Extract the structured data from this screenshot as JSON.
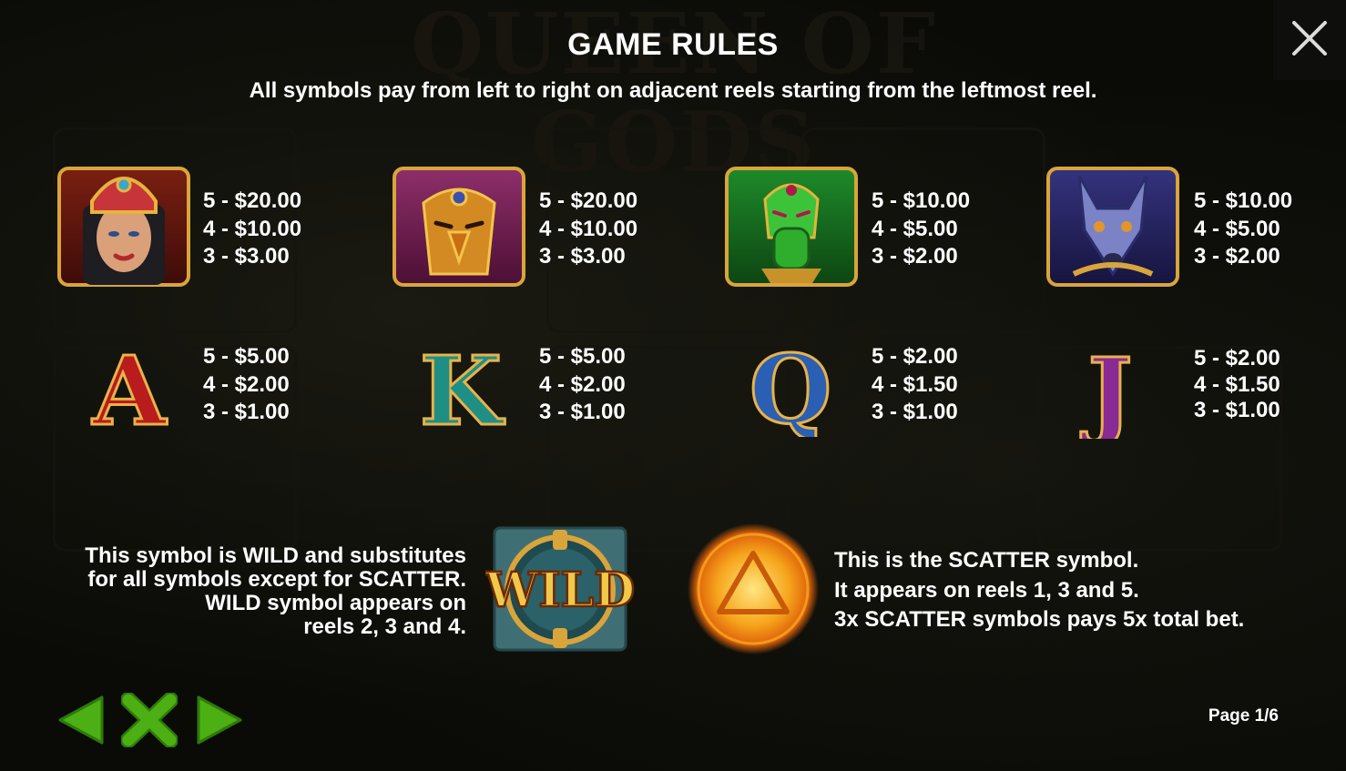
{
  "background": {
    "watermark_title": "QUEEN OF GODS"
  },
  "header": {
    "title": "GAME RULES",
    "subtitle": "All symbols pay from left to right on adjacent reels starting from the leftmost reel."
  },
  "symbols": [
    {
      "name": "queen",
      "pays": [
        "5 - $20.00",
        "4 - $10.00",
        "3 - $3.00"
      ]
    },
    {
      "name": "falcon",
      "pays": [
        "5 - $20.00",
        "4 - $10.00",
        "3 - $3.00"
      ]
    },
    {
      "name": "crocodile",
      "pays": [
        "5 - $10.00",
        "4 - $5.00",
        "3 - $2.00"
      ]
    },
    {
      "name": "jackal",
      "pays": [
        "5 - $10.00",
        "4 - $5.00",
        "3 - $2.00"
      ]
    },
    {
      "name": "letter-a",
      "letter": "A",
      "pays": [
        "5 - $5.00",
        "4 - $2.00",
        "3 - $1.00"
      ]
    },
    {
      "name": "letter-k",
      "letter": "K",
      "pays": [
        "5 - $5.00",
        "4 - $2.00",
        "3 - $1.00"
      ]
    },
    {
      "name": "letter-q",
      "letter": "Q",
      "pays": [
        "5 - $2.00",
        "4 - $1.50",
        "3 - $1.00"
      ]
    },
    {
      "name": "letter-j",
      "letter": "J",
      "pays": [
        "5 - $2.00",
        "4 - $1.50",
        "3 - $1.00"
      ]
    }
  ],
  "wild": {
    "icon_label": "WILD",
    "lines": [
      "This symbol is WILD and substitutes",
      "for all symbols except for SCATTER.",
      "WILD symbol appears on",
      "reels 2, 3 and 4."
    ]
  },
  "scatter": {
    "lines": [
      "This is the SCATTER symbol.",
      "It appears on reels 1, 3 and 5.",
      "3x SCATTER symbols pays 5x total bet."
    ]
  },
  "footer": {
    "page_label": "Page 1/6"
  },
  "colors": {
    "nav_green": "#4caf14",
    "text": "#ffffff"
  },
  "icons": {
    "close": "close-icon",
    "prev": "arrow-left-icon",
    "exit": "x-icon",
    "next": "arrow-right-icon"
  }
}
